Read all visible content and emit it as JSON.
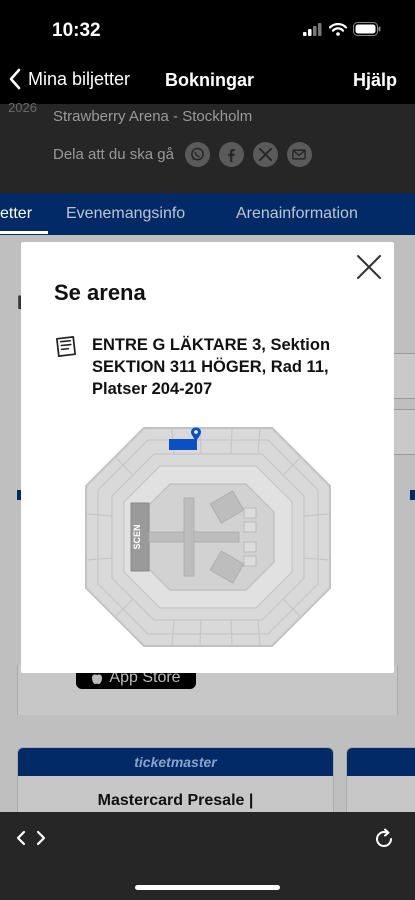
{
  "status": {
    "time": "10:32"
  },
  "nav": {
    "back_label": "Mina biljetter",
    "title": "Bokningar",
    "help_label": "Hjälp"
  },
  "event": {
    "year_fragment": "2026",
    "venue": "Strawberry Arena - Stockholm",
    "share_label": "Dela att du ska gå",
    "share_icons": [
      "whatsapp-icon",
      "facebook-icon",
      "x-icon",
      "mail-icon"
    ]
  },
  "tabs": [
    {
      "label": "etter",
      "active": true
    },
    {
      "label": "Evenemangsinfo",
      "active": false
    },
    {
      "label": "Arenainformation",
      "active": false
    }
  ],
  "background": {
    "heading_fragment": "I",
    "app_store_label": "App Store",
    "ticketmaster_brand": "ticketmaster",
    "presale_title": "Mastercard Presale |"
  },
  "modal": {
    "title": "Se arena",
    "ticket_info": "ENTRE G LÄKTARE 3, Sektion SEKTION 311 HÖGER, Rad 11, Platser 204-207",
    "stage_label": "SCEN"
  },
  "colors": {
    "brand_blue": "#022a66",
    "highlight_blue": "#0a4fc4",
    "map_gray": "#d4d4d4"
  }
}
